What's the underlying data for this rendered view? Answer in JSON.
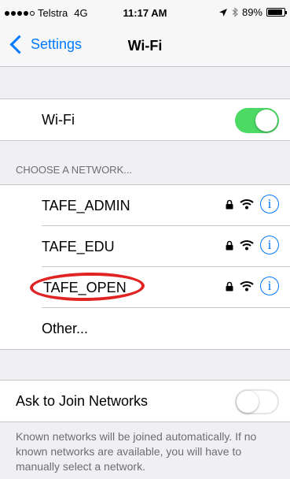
{
  "status_bar": {
    "carrier": "Telstra",
    "network": "4G",
    "time": "11:17 AM",
    "battery": "89%",
    "battery_level": 0.89
  },
  "nav": {
    "back_label": "Settings",
    "title": "Wi-Fi"
  },
  "wifi": {
    "label": "Wi-Fi",
    "enabled": true
  },
  "networks_section": {
    "header": "CHOOSE A NETWORK...",
    "items": [
      {
        "name": "TAFE_ADMIN",
        "secured": true
      },
      {
        "name": "TAFE_EDU",
        "secured": true
      },
      {
        "name": "TAFE_OPEN",
        "secured": true,
        "highlighted": true
      }
    ],
    "other_label": "Other..."
  },
  "ask_to_join": {
    "label": "Ask to Join Networks",
    "enabled": false,
    "footer": "Known networks will be joined automatically. If no known networks are available, you will have to manually select a network."
  },
  "colors": {
    "accent": "#007aff",
    "toggle_on": "#4cd964",
    "annotation": "#e02424"
  },
  "icons": [
    "signal-dots-icon",
    "location-arrow-icon",
    "bluetooth-icon",
    "battery-icon",
    "chevron-left-icon",
    "lock-icon",
    "wifi-icon",
    "info-icon"
  ]
}
